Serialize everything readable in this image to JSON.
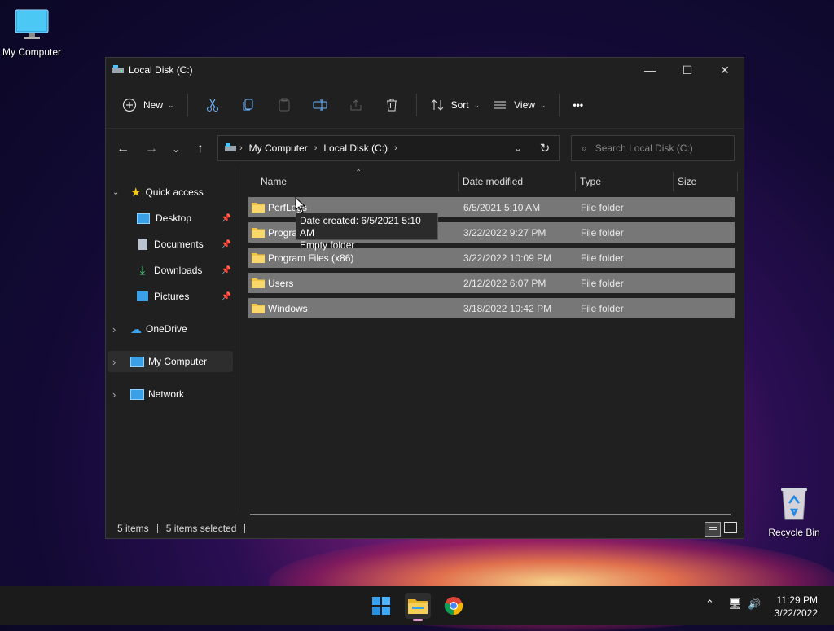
{
  "desktop": {
    "icons": [
      {
        "label": "My Computer"
      },
      {
        "label": "Recycle Bin"
      }
    ]
  },
  "window": {
    "title": "Local Disk (C:)",
    "controls": {
      "minimize": "—",
      "maximize": "☐",
      "close": "✕"
    }
  },
  "toolbar": {
    "new_label": "New",
    "sort_label": "Sort",
    "view_label": "View",
    "more_label": "•••"
  },
  "address": {
    "segments": [
      "My Computer",
      "Local Disk (C:)"
    ]
  },
  "search": {
    "placeholder": "Search Local Disk (C:)"
  },
  "sidebar": {
    "items": [
      {
        "label": "Quick access"
      },
      {
        "label": "Desktop"
      },
      {
        "label": "Documents"
      },
      {
        "label": "Downloads"
      },
      {
        "label": "Pictures"
      },
      {
        "label": "OneDrive"
      },
      {
        "label": "My Computer"
      },
      {
        "label": "Network"
      }
    ]
  },
  "columns": {
    "name": "Name",
    "date": "Date modified",
    "type": "Type",
    "size": "Size"
  },
  "files": [
    {
      "name": "PerfLogs",
      "date": "6/5/2021 5:10 AM",
      "type": "File folder"
    },
    {
      "name": "Program Files",
      "date": "3/22/2022 9:27 PM",
      "type": "File folder"
    },
    {
      "name": "Program Files (x86)",
      "date": "3/22/2022 10:09 PM",
      "type": "File folder"
    },
    {
      "name": "Users",
      "date": "2/12/2022 6:07 PM",
      "type": "File folder"
    },
    {
      "name": "Windows",
      "date": "3/18/2022 10:42 PM",
      "type": "File folder"
    }
  ],
  "tooltip": {
    "line1": "Date created: 6/5/2021 5:10 AM",
    "line2": "Empty folder"
  },
  "status": {
    "items": "5 items",
    "selected": "5 items selected"
  },
  "taskbar": {
    "time": "11:29 PM",
    "date": "3/22/2022"
  },
  "colors": {
    "accent": "#4cc2ff",
    "folder": "#f4c542",
    "row_selected": "#777777"
  }
}
